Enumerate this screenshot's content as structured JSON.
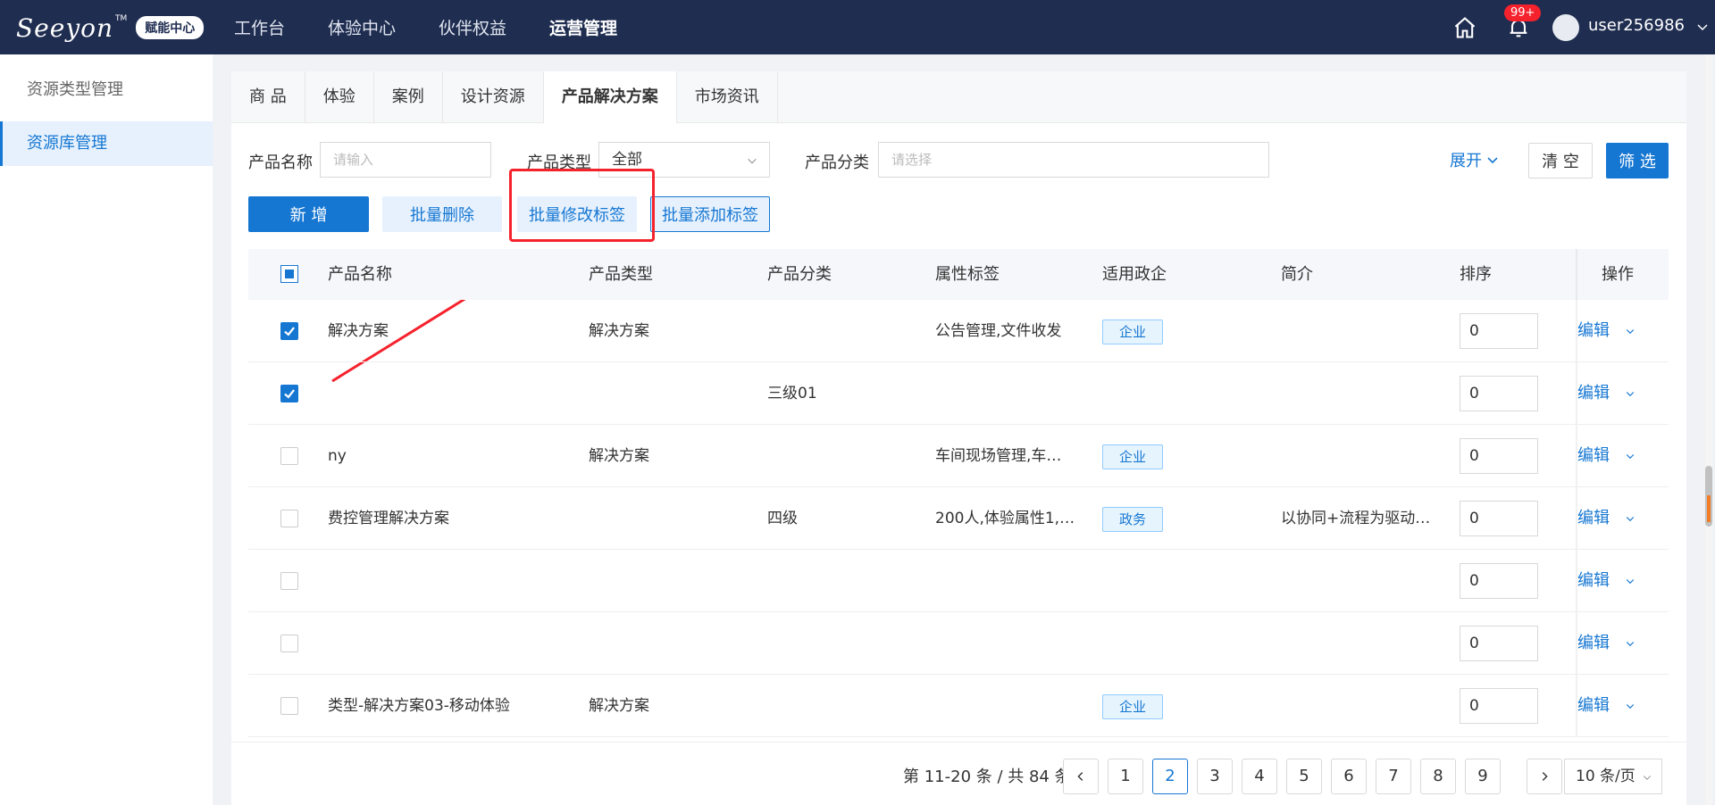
{
  "header": {
    "logo_text": "Seeyon",
    "logo_tm": "TM",
    "logo_badge": "赋能中心",
    "nav": [
      "工作台",
      "体验中心",
      "伙伴权益",
      "运营管理"
    ],
    "notification_count": "99+",
    "username": "user256986"
  },
  "sidebar": {
    "items": [
      "资源类型管理",
      "资源库管理"
    ]
  },
  "tabs": [
    "商 品",
    "体验",
    "案例",
    "设计资源",
    "产品解决方案",
    "市场资讯"
  ],
  "filters": {
    "name_label": "产品名称",
    "name_placeholder": "请输入",
    "type_label": "产品类型",
    "type_value": "全部",
    "category_label": "产品分类",
    "category_placeholder": "请选择",
    "expand_label": "展开",
    "clear_label": "清 空",
    "filter_label": "筛 选"
  },
  "actions": {
    "add": "新 增",
    "batch_delete": "批量删除",
    "batch_edit_tags": "批量修改标签",
    "batch_add_tags": "批量添加标签"
  },
  "table": {
    "columns": [
      "产品名称",
      "产品类型",
      "产品分类",
      "属性标签",
      "适用政企",
      "简介",
      "排序",
      "操作"
    ],
    "edit_label": "编辑",
    "rows": [
      {
        "checked": true,
        "name": "解决方案",
        "type": "解决方案",
        "category": "",
        "tags": "公告管理,文件收发",
        "org": "企业",
        "intro": "",
        "sort": "0"
      },
      {
        "checked": true,
        "name": "",
        "type": "",
        "category": "三级01",
        "tags": "",
        "org": "",
        "intro": "",
        "sort": "0"
      },
      {
        "checked": false,
        "name": "ny",
        "type": "解决方案",
        "category": "",
        "tags": "车间现场管理,车…",
        "org": "企业",
        "intro": "",
        "sort": "0"
      },
      {
        "checked": false,
        "name": "费控管理解决方案",
        "type": "",
        "category": "四级",
        "tags": "200人,体验属性1,…",
        "org": "政务",
        "intro": "以协同+流程为驱动…",
        "sort": "0"
      },
      {
        "checked": false,
        "name": "",
        "type": "",
        "category": "",
        "tags": "",
        "org": "",
        "intro": "",
        "sort": "0"
      },
      {
        "checked": false,
        "name": "",
        "type": "",
        "category": "",
        "tags": "",
        "org": "",
        "intro": "",
        "sort": "0"
      },
      {
        "checked": false,
        "name": "类型-解决方案03-移动体验",
        "type": "解决方案",
        "category": "",
        "tags": "",
        "org": "企业",
        "intro": "",
        "sort": "0"
      }
    ]
  },
  "pagination": {
    "summary": "第 11-20 条 / 共 84 条",
    "pages": [
      "1",
      "2",
      "3",
      "4",
      "5",
      "6",
      "7",
      "8",
      "9"
    ],
    "current": "2",
    "page_size": "10 条/页"
  },
  "colors": {
    "primary": "#1677d2",
    "header_bg": "#1f2d50",
    "highlight": "#f5222d"
  }
}
